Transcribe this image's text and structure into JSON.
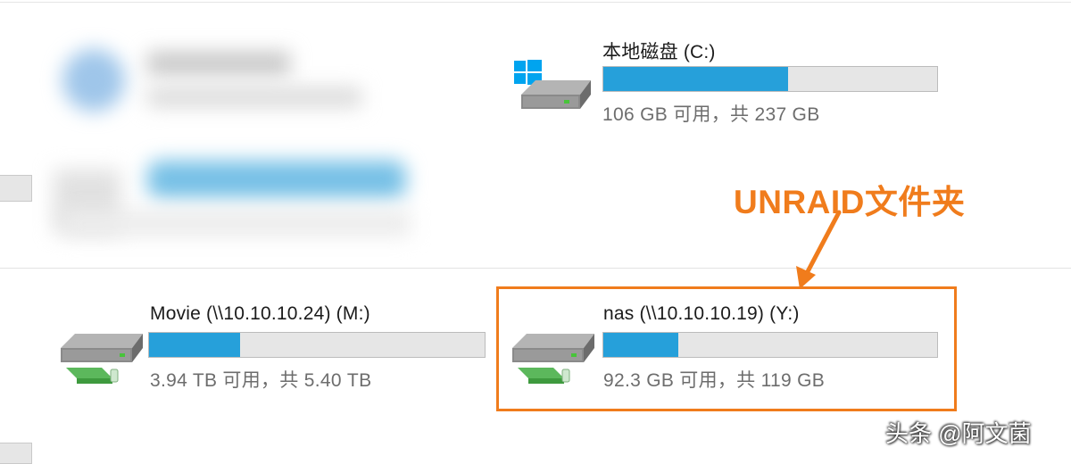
{
  "drives": [
    {
      "name": "本地磁盘 (C:)",
      "space_text": "106 GB 可用，共 237 GB",
      "used_fraction": 0.553,
      "icon": "windows-system-drive-icon"
    },
    {
      "name": "Movie (\\\\10.10.10.24) (M:)",
      "space_text": "3.94 TB 可用，共 5.40 TB",
      "used_fraction": 0.27,
      "icon": "network-drive-icon"
    },
    {
      "name": "nas (\\\\10.10.10.19) (Y:)",
      "space_text": "92.3 GB 可用，共 119 GB",
      "used_fraction": 0.224,
      "icon": "network-drive-icon"
    }
  ],
  "annotation": {
    "label": "UNRAID文件夹"
  },
  "watermark": {
    "text": "头条 @阿文菌"
  },
  "colors": {
    "bar_fill": "#26a0da",
    "bar_track": "#e6e6e6",
    "annotation": "#f07c1c",
    "windows_logo": "#00a4ef",
    "network_cable": "#5cb85c"
  }
}
